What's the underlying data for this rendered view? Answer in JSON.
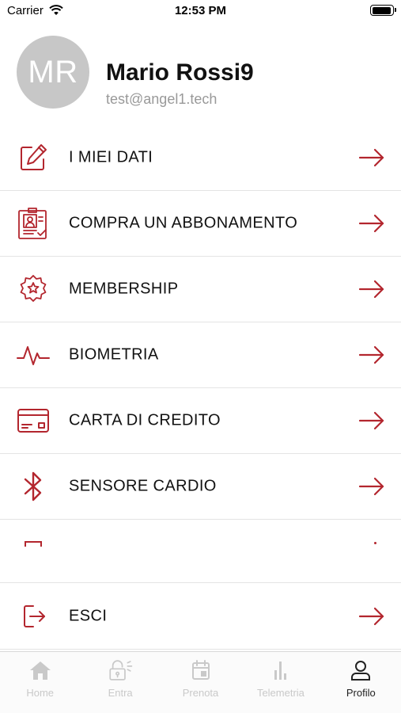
{
  "status_bar": {
    "carrier": "Carrier",
    "time": "12:53 PM"
  },
  "profile": {
    "initials": "MR",
    "name": "Mario Rossi9",
    "email": "test@angel1.tech"
  },
  "menu": {
    "items": [
      {
        "label": "I MIEI DATI",
        "icon": "edit-icon"
      },
      {
        "label": "COMPRA UN ABBONAMENTO",
        "icon": "id-badge-icon"
      },
      {
        "label": "MEMBERSHIP",
        "icon": "star-badge-icon"
      },
      {
        "label": "BIOMETRIA",
        "icon": "heartbeat-icon"
      },
      {
        "label": "CARTA DI CREDITO",
        "icon": "credit-card-icon"
      },
      {
        "label": "SENSORE CARDIO",
        "icon": "bluetooth-icon"
      },
      {
        "label": "",
        "icon": "partial-icon"
      },
      {
        "label": "ESCI",
        "icon": "logout-icon"
      }
    ]
  },
  "tab_bar": {
    "tabs": [
      {
        "label": "Home",
        "icon": "home-icon"
      },
      {
        "label": "Entra",
        "icon": "lock-icon"
      },
      {
        "label": "Prenota",
        "icon": "calendar-icon"
      },
      {
        "label": "Telemetria",
        "icon": "bar-chart-icon"
      },
      {
        "label": "Profilo",
        "icon": "user-icon"
      }
    ],
    "active": "Profilo"
  },
  "colors": {
    "accent": "#b3262e",
    "inactive_tab": "#c9c9c9",
    "active_tab": "#222222",
    "avatar_bg": "#c7c7c7"
  }
}
